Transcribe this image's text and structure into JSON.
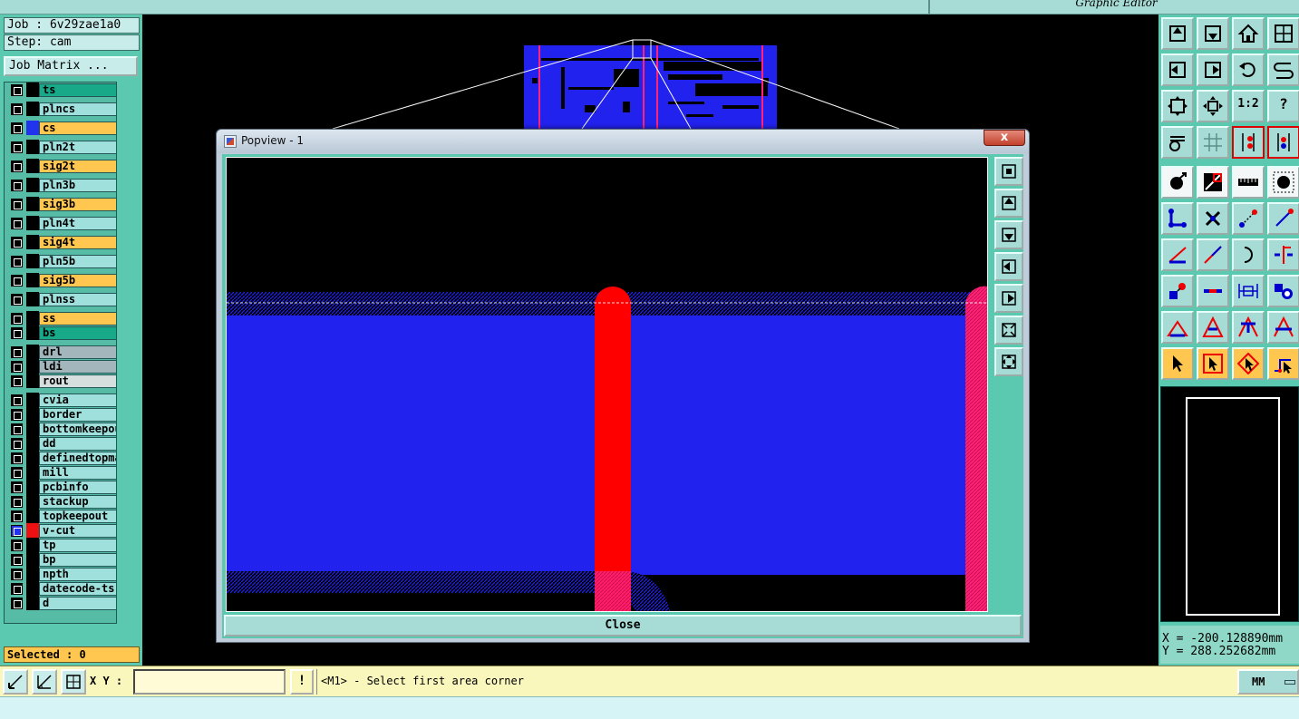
{
  "window": {
    "title": "Graphic Editor"
  },
  "job": {
    "job_label": "Job : 6v29zae1a0",
    "step_label": "Step: cam",
    "matrix_button": "Job Matrix ..."
  },
  "layers": [
    {
      "name": "ts",
      "color": "green"
    },
    {
      "name": "plncs",
      "color": "cyan"
    },
    {
      "name": "cs",
      "color": "orange",
      "swatch": "#2233ee"
    },
    {
      "name": "pln2t",
      "color": "cyan"
    },
    {
      "name": "sig2t",
      "color": "orange"
    },
    {
      "name": "pln3b",
      "color": "cyan"
    },
    {
      "name": "sig3b",
      "color": "orange"
    },
    {
      "name": "pln4t",
      "color": "cyan"
    },
    {
      "name": "sig4t",
      "color": "orange"
    },
    {
      "name": "pln5b",
      "color": "cyan"
    },
    {
      "name": "sig5b",
      "color": "orange"
    },
    {
      "name": "plnss",
      "color": "cyan"
    },
    {
      "name": "ss",
      "color": "orange"
    },
    {
      "name": "bs",
      "color": "green"
    },
    {
      "name": "drl",
      "color": "grey"
    },
    {
      "name": "ldi",
      "color": "grey"
    },
    {
      "name": "rout",
      "color": "lgrey"
    },
    {
      "name": "cvia",
      "color": "cyan"
    },
    {
      "name": "border",
      "color": "cyan"
    },
    {
      "name": "bottomkeepou",
      "color": "cyan"
    },
    {
      "name": "dd",
      "color": "cyan"
    },
    {
      "name": "definedtopma",
      "color": "cyan"
    },
    {
      "name": "mill",
      "color": "cyan"
    },
    {
      "name": "pcbinfo",
      "color": "cyan"
    },
    {
      "name": "stackup",
      "color": "cyan"
    },
    {
      "name": "topkeepout",
      "color": "cyan"
    },
    {
      "name": "v-cut",
      "color": "cyan",
      "swatch": "#ee1111",
      "active": true
    },
    {
      "name": "tp",
      "color": "cyan"
    },
    {
      "name": "bp",
      "color": "cyan"
    },
    {
      "name": "npth",
      "color": "cyan"
    },
    {
      "name": "datecode-ts",
      "color": "cyan"
    },
    {
      "name": "d",
      "color": "cyan"
    }
  ],
  "selected": "Selected : 0",
  "popview": {
    "title": "Popview - 1",
    "close_x": "x",
    "close_button": "Close"
  },
  "coords": {
    "x": "X = -200.128890mm",
    "y": "Y = 288.252682mm"
  },
  "toolbar": {
    "one_to_two_label": "1:2",
    "help_label": "?"
  },
  "bottom": {
    "xy_label": "X Y :",
    "xy_value": "",
    "warn_label": "!",
    "status": "<M1> - Select first area corner",
    "unit": "MM"
  },
  "colors": {
    "panel": "#5ac9b0",
    "layer_green": "#17a988",
    "layer_cyan": "#9fe0dc",
    "layer_orange": "#ffc650",
    "copper_blue": "#2222ee",
    "trace_red": "#ff0000",
    "vcut_pink": "#ff2277"
  }
}
